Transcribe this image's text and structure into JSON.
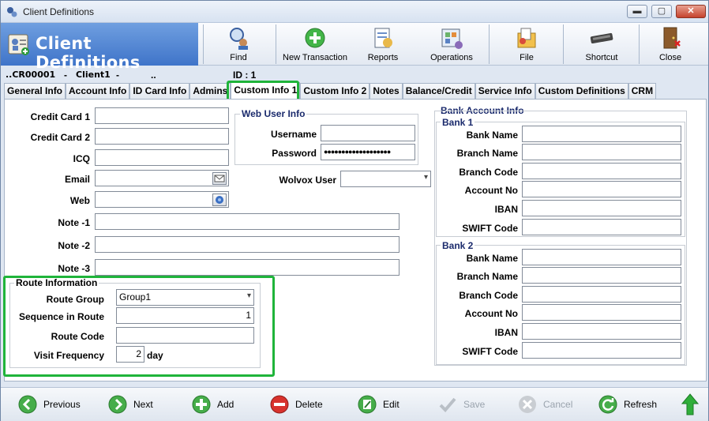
{
  "window": {
    "title": "Client Definitions",
    "min": "▬",
    "max": "▢",
    "close": "✕"
  },
  "header": {
    "title": "Client Definitions"
  },
  "toolbar": [
    "Find",
    "New Transaction",
    "Reports",
    "Operations",
    "File",
    "Shortcut",
    "Close"
  ],
  "idbar": {
    "code": "CR00001",
    "name": "Client1",
    "dot": "..",
    "id": "ID : 1",
    "dash1": "-",
    "dash2": "-"
  },
  "tabs": [
    "General Info",
    "Account Info",
    "ID Card Info",
    "Admins",
    "Custom Info 1",
    "Custom Info 2",
    "Notes",
    "Balance/Credit",
    "Service Info",
    "Custom Definitions",
    "CRM"
  ],
  "form": {
    "credit_card_1": "Credit Card 1",
    "credit_card_2": "Credit Card 2",
    "icq": "ICQ",
    "email": "Email",
    "web": "Web",
    "note1": "Note -1",
    "note2": "Note -2",
    "note3": "Note -3"
  },
  "web_user": {
    "title": "Web User Info",
    "username_label": "Username",
    "password_label": "Password",
    "username": "",
    "password": "●●●●●●●●●●●●●●●●●●●",
    "wolvox_label": "Wolvox User",
    "wolvox_value": ""
  },
  "route": {
    "title": "Route Information",
    "group_label": "Route Group",
    "group_value": "Group1",
    "sequence_label": "Sequence in Route",
    "sequence_value": "1",
    "code_label": "Route Code",
    "code_value": "",
    "freq_label": "Visit Frequency",
    "freq_value": "2",
    "freq_unit": "day"
  },
  "bank": {
    "title": "Bank Account Info",
    "bank1": "Bank 1",
    "bank2": "Bank 2",
    "fields": [
      "Bank Name",
      "Branch Name",
      "Branch Code",
      "Account No",
      "IBAN",
      "SWIFT Code"
    ]
  },
  "bottom": [
    "Previous",
    "Next",
    "Add",
    "Delete",
    "Edit",
    "Save",
    "Cancel",
    "Refresh"
  ],
  "colors": {
    "highlight": "#1fb43a",
    "header_blue": "#3f74c9"
  }
}
